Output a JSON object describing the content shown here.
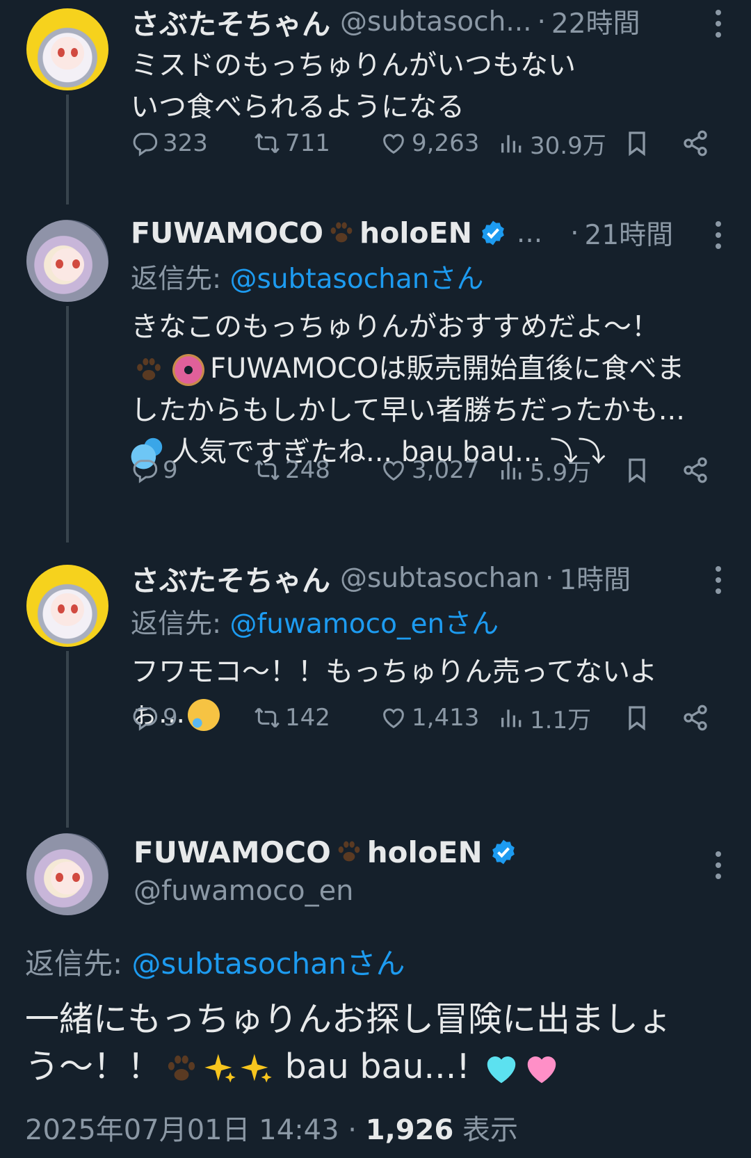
{
  "tweets": [
    {
      "name": "さぶたそちゃん",
      "handle": "@subtasoch...",
      "time": "22時間",
      "reply_prefix": "",
      "reply_to": "",
      "text_lines": [
        "ミスドのもっちゅりんがいつもない",
        "いつ食べられるようになる"
      ],
      "replies": "323",
      "retweets": "711",
      "likes": "9,263",
      "views": "30.9万"
    },
    {
      "name": "FUWAMOCO",
      "name_suffix": "holoEN",
      "handle": "...",
      "time": "21時間",
      "reply_prefix": "返信先: ",
      "reply_to": "@subtasochanさん",
      "text_lines": [
        "きなこのもっちゅりんがおすすめだよ～！",
        "FUWAMOCOは販売開始直後に食べま",
        "したからもしかして早い者勝ちだったかも...",
        "人気ですぎたね... bau bau... ⤵⤵"
      ],
      "replies": "9",
      "retweets": "248",
      "likes": "3,027",
      "views": "5.9万"
    },
    {
      "name": "さぶたそちゃん",
      "handle": "@subtasochan",
      "time": "1時間",
      "reply_prefix": "返信先: ",
      "reply_to": "@fuwamoco_enさん",
      "text_lines": [
        "フワモコ～！！もっちゅりん売ってないよ",
        "ぉ..."
      ],
      "replies": "9",
      "retweets": "142",
      "likes": "1,413",
      "views": "1.1万"
    }
  ],
  "main": {
    "name": "FUWAMOCO",
    "name_suffix": "holoEN",
    "handle": "@fuwamoco_en",
    "reply_prefix": "返信先: ",
    "reply_to": "@subtasochanさん",
    "text_line1": "一緒にもっちゅりんお探し冒険に出ましょ",
    "text_line2_start": "う～！！",
    "text_line2_mid": " bau bau...! ",
    "date": "2025年07月01日 14:43",
    "sep": " · ",
    "views": "1,926",
    "views_label": " 表示"
  },
  "colors": {
    "background": "#15202b",
    "text": "#e7e9ea",
    "muted": "#8b98a5",
    "link": "#1d9bf0",
    "verified": "#1d9bf0"
  },
  "icons": [
    "reply-icon",
    "retweet-icon",
    "like-icon",
    "views-icon",
    "bookmark-icon",
    "share-icon",
    "more-icon",
    "verified-badge-icon",
    "paw-emoji",
    "donut-emoji",
    "sweat-emoji",
    "tear-smile-emoji",
    "sparkles-emoji",
    "light-blue-heart-emoji",
    "pink-heart-emoji"
  ]
}
